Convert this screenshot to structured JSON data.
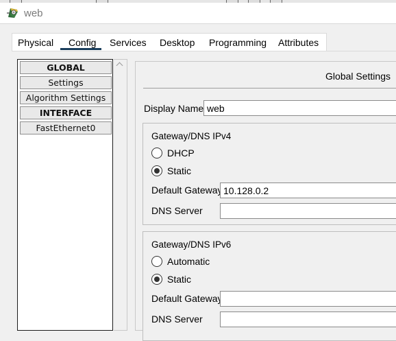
{
  "window": {
    "title": "web",
    "app_icon": "packet-tracer-device-icon"
  },
  "tabs": [
    "Physical",
    "Config",
    "Services",
    "Desktop",
    "Programming",
    "Attributes"
  ],
  "active_tab": "Config",
  "sidebar": {
    "items": [
      {
        "label": "GLOBAL",
        "type": "header"
      },
      {
        "label": "Settings",
        "type": "item"
      },
      {
        "label": "Algorithm Settings",
        "type": "item"
      },
      {
        "label": "INTERFACE",
        "type": "header"
      },
      {
        "label": "FastEthernet0",
        "type": "item"
      }
    ]
  },
  "main": {
    "section_title": "Global Settings",
    "display_name": {
      "label": "Display Name",
      "value": "web"
    },
    "ipv4": {
      "title": "Gateway/DNS IPv4",
      "options": [
        {
          "label": "DHCP",
          "selected": false
        },
        {
          "label": "Static",
          "selected": true
        }
      ],
      "default_gateway": {
        "label": "Default Gateway",
        "value": "10.128.0.2"
      },
      "dns_server": {
        "label": "DNS Server",
        "value": ""
      }
    },
    "ipv6": {
      "title": "Gateway/DNS IPv6",
      "options": [
        {
          "label": "Automatic",
          "selected": false
        },
        {
          "label": "Static",
          "selected": true
        }
      ],
      "default_gateway": {
        "label": "Default Gateway",
        "value": ""
      },
      "dns_server": {
        "label": "DNS Server",
        "value": ""
      }
    }
  },
  "colors": {
    "tab_underline": "#1a3e5c",
    "panel_bg": "#f0f0f0",
    "title_text": "#7b7b7b"
  }
}
